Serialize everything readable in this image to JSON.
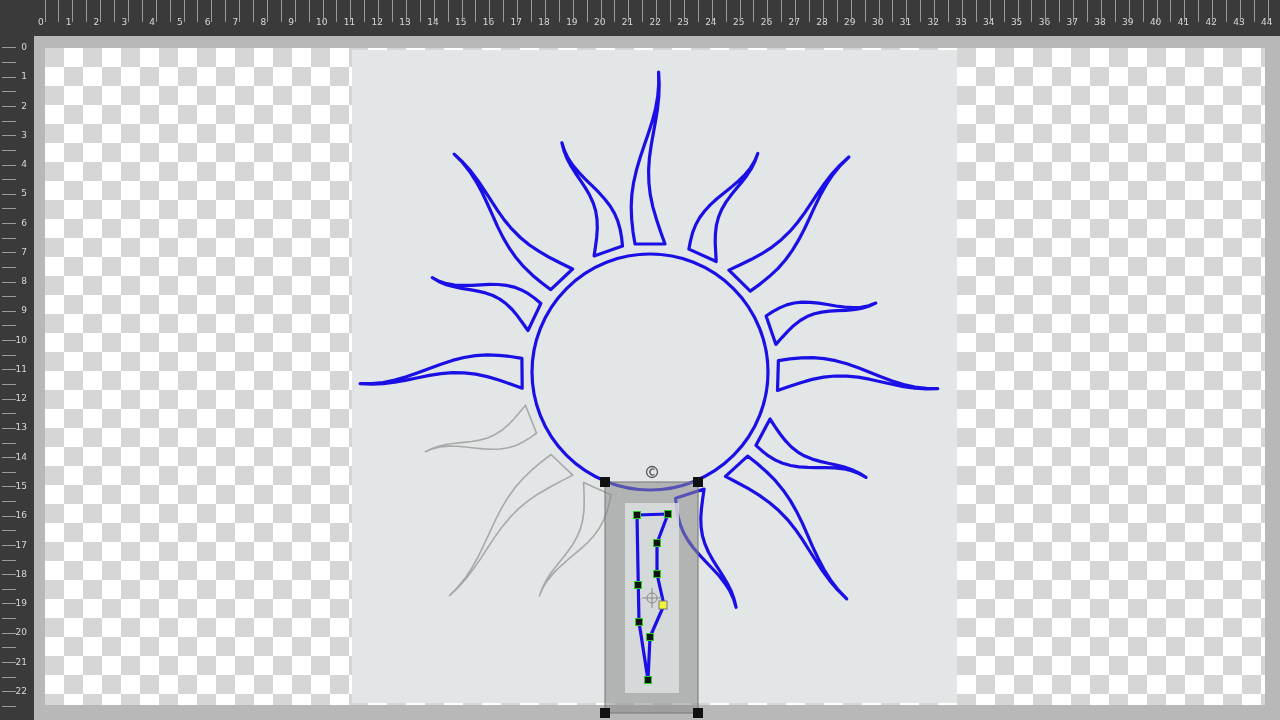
{
  "rulers": {
    "horizontal": [
      "0",
      "1",
      "2",
      "3",
      "4",
      "5",
      "6",
      "7",
      "8",
      "9",
      "10",
      "11",
      "12",
      "13",
      "14",
      "15",
      "16",
      "17",
      "18",
      "19",
      "20",
      "21",
      "22",
      "23",
      "24",
      "25",
      "26",
      "27",
      "28",
      "29",
      "30",
      "31",
      "32",
      "33",
      "34",
      "35",
      "36",
      "37",
      "38",
      "39",
      "40",
      "41",
      "42",
      "43",
      "44"
    ],
    "vertical": [
      "0",
      "1",
      "2",
      "3",
      "4",
      "5",
      "6",
      "7",
      "8",
      "9",
      "10",
      "11",
      "12",
      "13",
      "14",
      "15",
      "16",
      "17",
      "18",
      "19",
      "20",
      "21",
      "22"
    ]
  }
}
